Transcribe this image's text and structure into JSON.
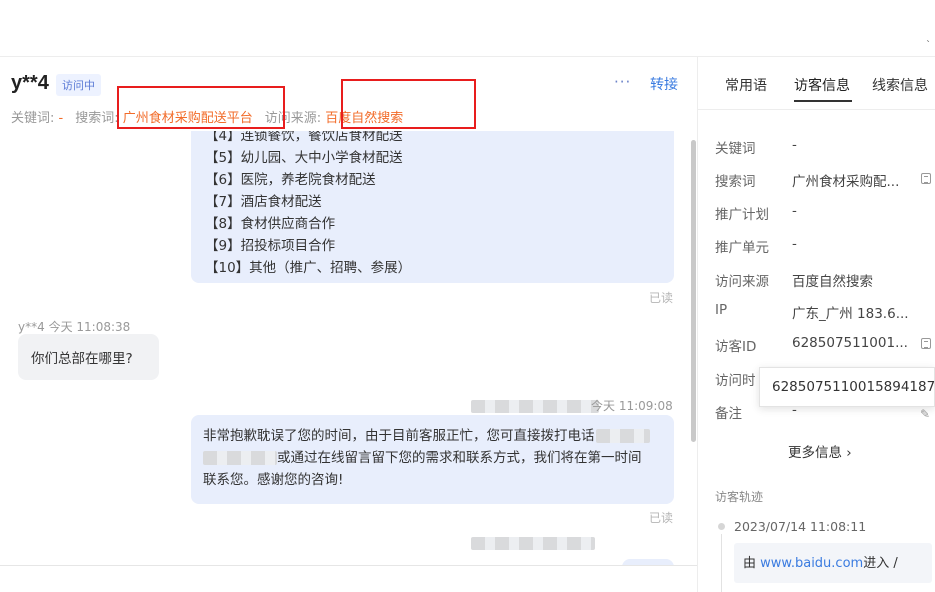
{
  "topbar": {
    "corner_mark": "ˋ"
  },
  "header": {
    "visitor_name": "y**4",
    "status_badge": "访问中",
    "more_label": "···",
    "transfer_label": "转接",
    "keyword_label": "关键词: ",
    "keyword_value": "-",
    "search_label": "搜索词: ",
    "search_value": "广州食材采购配送平台",
    "source_label": "访问来源: ",
    "source_value": "百度自然搜索"
  },
  "messages": {
    "menu_bubble": {
      "lines": [
        "【4】连锁餐饮，餐饮店食材配送",
        "【5】幼儿园、大中小学食材配送",
        "【6】医院，养老院食材配送",
        "【7】酒店食材配送",
        "【8】食材供应商合作",
        "【9】招投标项目合作",
        "【10】其他（推广、招聘、参展）"
      ],
      "read": "已读"
    },
    "visitor_msg": {
      "sender": "y**4",
      "time": "今天 11:08:38",
      "text": "你们总部在哪里?"
    },
    "agent_msg": {
      "time_suffix": "今天 11:09:08",
      "line1": "非常抱歉耽误了您的时间，由于目前客服正忙，您可直接拨打电话",
      "line2": "或通过在线留言留下您的需求和联系方式，我们将在第一时间",
      "line3": "联系您。感谢您的咨询!",
      "read": "已读"
    }
  },
  "panel": {
    "tabs": [
      "常用语",
      "访客信息",
      "线索信息"
    ],
    "active_tab": "访客信息",
    "rows": [
      {
        "label": "关键词",
        "value": "-"
      },
      {
        "label": "搜索词",
        "value": "广州食材采购配..."
      },
      {
        "label": "推广计划",
        "value": "-"
      },
      {
        "label": "推广单元",
        "value": "-"
      },
      {
        "label": "访问来源",
        "value": "百度自然搜索"
      },
      {
        "label": "IP",
        "value": "广东_广州 183.6..."
      },
      {
        "label": "访客ID",
        "value": "628507511001..."
      },
      {
        "label": "访问时",
        "value": ""
      },
      {
        "label": "备注",
        "value": "-"
      }
    ],
    "tooltip_value": "6285075110015894187",
    "more_info": "更多信息 ›",
    "trail_title": "访客轨迹",
    "trail_time": "2023/07/14 11:08:11",
    "trail_prefix": "由 ",
    "trail_link": "www.baidu.com",
    "trail_suffix": "进入 /"
  },
  "colors": {
    "accent": "#3a7be0",
    "highlight_orange": "#f26c2a",
    "annotation_red": "#e81d1d",
    "agent_bubble": "#e8eefc",
    "visitor_bubble": "#f1f2f4"
  }
}
